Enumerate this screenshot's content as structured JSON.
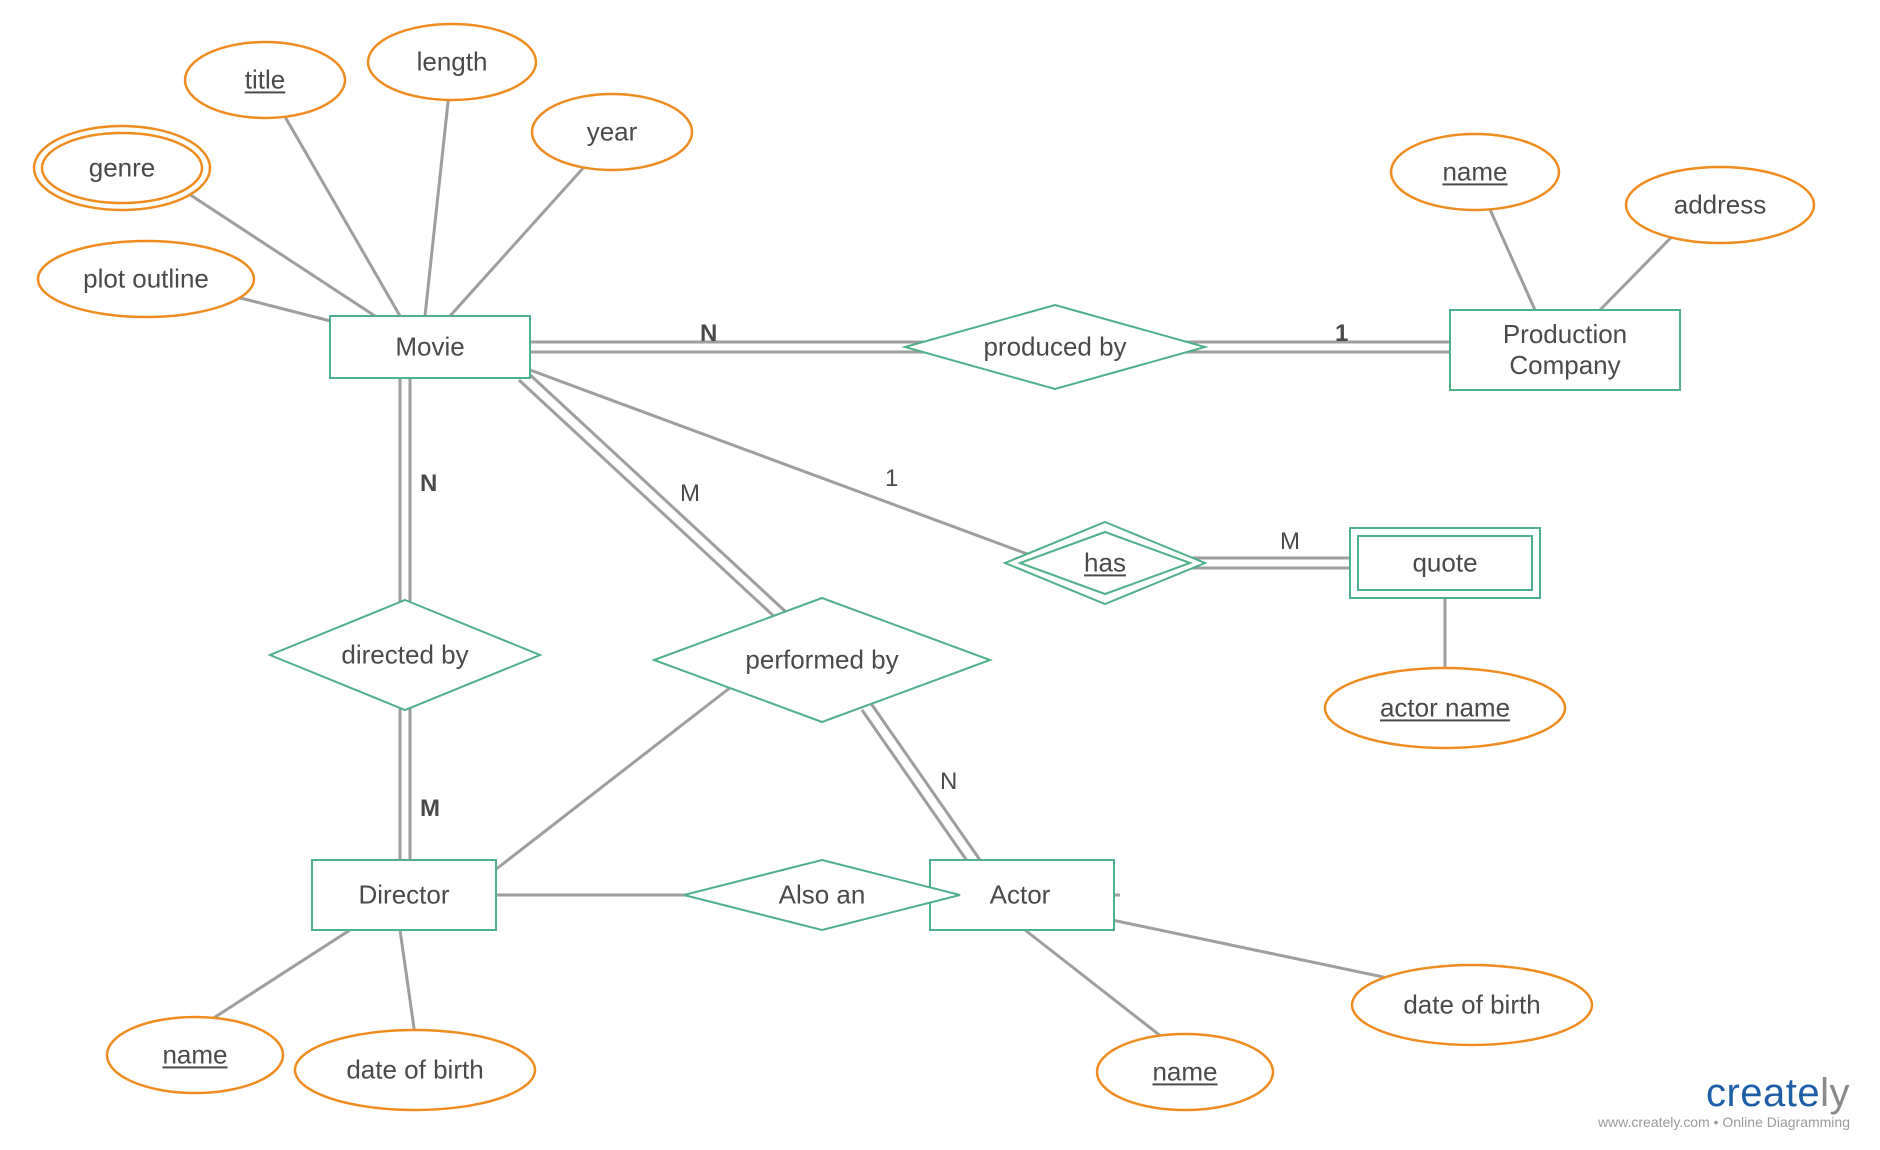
{
  "entities": {
    "movie": "Movie",
    "production_company": "Production\nCompany",
    "director": "Director",
    "actor": "Actor",
    "quote": "quote"
  },
  "relationships": {
    "produced_by": "produced by",
    "directed_by": "directed by",
    "performed_by": "performed by",
    "has": "has",
    "also_an": "Also an"
  },
  "attributes": {
    "genre": "genre",
    "title": "title",
    "length": "length",
    "year": "year",
    "plot_outline": "plot outline",
    "pc_name": "name",
    "pc_address": "address",
    "actor_name_attr": "actor name",
    "director_name": "name",
    "director_dob": "date of birth",
    "actor_name": "name",
    "actor_dob": "date of birth"
  },
  "cardinalities": {
    "movie_produced": "N",
    "produced_company": "1",
    "movie_directed": "N",
    "directed_director": "M",
    "movie_performed": "M",
    "performed_actor": "N",
    "movie_has": "1",
    "has_quote": "M"
  },
  "watermark": {
    "brand_part1": "create",
    "brand_part2": "ly",
    "subtitle": "www.creately.com • Online Diagramming"
  }
}
